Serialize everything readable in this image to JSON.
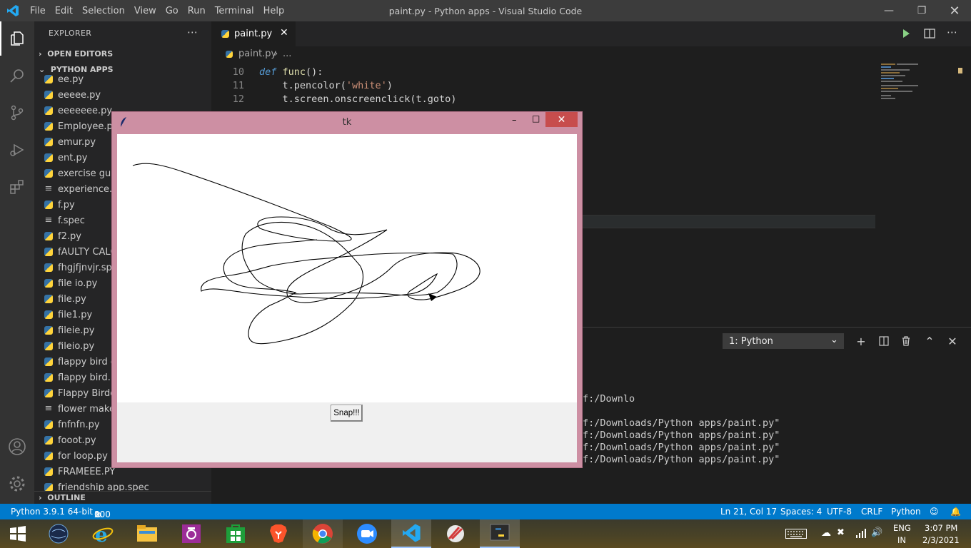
{
  "titlebar": {
    "menu": [
      "File",
      "Edit",
      "Selection",
      "View",
      "Go",
      "Run",
      "Terminal",
      "Help"
    ],
    "window_title": "paint.py - Python apps - Visual Studio Code"
  },
  "sidebar": {
    "header": "EXPLORER",
    "open_editors": "OPEN EDITORS",
    "folder": "PYTHON APPS",
    "outline": "OUTLINE",
    "files": [
      {
        "name": "ee.py",
        "type": "py"
      },
      {
        "name": "eeeee.py",
        "type": "py"
      },
      {
        "name": "eeeeeee.py",
        "type": "py"
      },
      {
        "name": "Employee.py",
        "type": "py"
      },
      {
        "name": "emur.py",
        "type": "py"
      },
      {
        "name": "ent.py",
        "type": "py"
      },
      {
        "name": "exercise gues",
        "type": "py"
      },
      {
        "name": "experience.tx",
        "type": "txt"
      },
      {
        "name": "f.py",
        "type": "py"
      },
      {
        "name": "f.spec",
        "type": "txt"
      },
      {
        "name": "f2.py",
        "type": "py"
      },
      {
        "name": "fAULTY CALC",
        "type": "py"
      },
      {
        "name": "fhgjfjnvjr.spe",
        "type": "py"
      },
      {
        "name": "file io.py",
        "type": "py"
      },
      {
        "name": "file.py",
        "type": "py"
      },
      {
        "name": "file1.py",
        "type": "py"
      },
      {
        "name": "fileie.py",
        "type": "py"
      },
      {
        "name": "fileio.py",
        "type": "py"
      },
      {
        "name": "flappy bird g",
        "type": "py"
      },
      {
        "name": "flappy bird.py",
        "type": "py"
      },
      {
        "name": "Flappy Birdo.",
        "type": "py"
      },
      {
        "name": "flower maker",
        "type": "txt"
      },
      {
        "name": "fnfnfn.py",
        "type": "py"
      },
      {
        "name": "fooot.py",
        "type": "py"
      },
      {
        "name": "for loop.py",
        "type": "py"
      },
      {
        "name": "FRAMEEE.PY",
        "type": "py"
      },
      {
        "name": "friendship app.spec",
        "type": "py"
      }
    ]
  },
  "editor": {
    "tab_label": "paint.py",
    "breadcrumb_file": "paint.py",
    "breadcrumb_more": "...",
    "lines": [
      {
        "num": "10",
        "kw": "def",
        "fn": "func",
        "rest": "():"
      },
      {
        "num": "11",
        "pre": "    t.pencolor(",
        "str": "'white'",
        "post": ")"
      },
      {
        "num": "12",
        "pre": "    t.screen.onscreenclick(t.goto)"
      }
    ]
  },
  "terminal": {
    "selected": "1: Python",
    "lines": [
      "f:/Downlo",
      "",
      "f:/Downloads/Python apps/paint.py\"",
      "f:/Downloads/Python apps/paint.py\"",
      "f:/Downloads/Python apps/paint.py\"",
      "f:/Downloads/Python apps/paint.py\""
    ]
  },
  "statusbar": {
    "interpreter": "Python 3.9.1 64-bit",
    "errors": "0",
    "warnings": "100",
    "position": "Ln 21, Col 17",
    "spaces": "Spaces: 4",
    "encoding": "UTF-8",
    "eol": "CRLF",
    "language": "Python"
  },
  "tk": {
    "title": "tk",
    "button": "Snap!!!"
  },
  "tray": {
    "lang1": "ENG",
    "lang2": "IN",
    "time": "3:07 PM",
    "date": "2/3/2021"
  },
  "colors": {
    "accent": "#007acc",
    "tk_frame": "#cd8fa3",
    "close_red": "#c74d4d"
  }
}
